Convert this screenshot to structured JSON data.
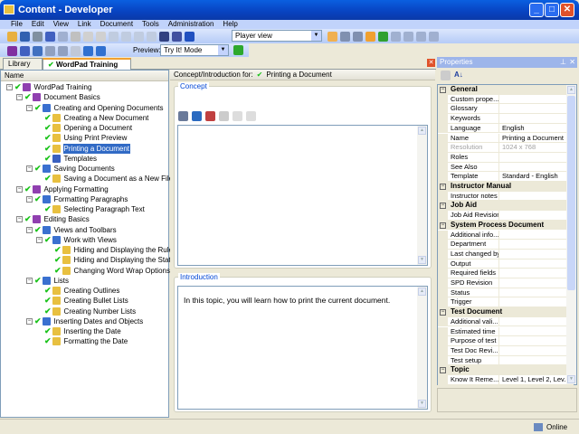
{
  "window": {
    "title": "Content - Developer",
    "minimize": "_",
    "maximize": "□",
    "close": "✕"
  },
  "menu": [
    "File",
    "Edit",
    "View",
    "Link",
    "Document",
    "Tools",
    "Administration",
    "Help"
  ],
  "toolbar": {
    "view_select": "Player view",
    "preview_label": "Preview:",
    "preview_select": "Try It! Mode"
  },
  "tabs": [
    {
      "label": "Library"
    },
    {
      "label": "WordPad Training"
    }
  ],
  "tree": {
    "header": "Name",
    "items": [
      {
        "label": "WordPad Training",
        "level": 0,
        "type": "book",
        "expand": "-"
      },
      {
        "label": "Document Basics",
        "level": 1,
        "type": "book",
        "expand": "-"
      },
      {
        "label": "Creating and Opening Documents",
        "level": 2,
        "type": "section",
        "expand": "-"
      },
      {
        "label": "Creating a New Document",
        "level": 3,
        "type": "topic"
      },
      {
        "label": "Opening a Document",
        "level": 3,
        "type": "topic"
      },
      {
        "label": "Using Print Preview",
        "level": 3,
        "type": "topic"
      },
      {
        "label": "Printing a Document",
        "level": 3,
        "type": "topic",
        "selected": true
      },
      {
        "label": "Templates",
        "level": 3,
        "type": "page"
      },
      {
        "label": "Saving Documents",
        "level": 2,
        "type": "section",
        "expand": "-"
      },
      {
        "label": "Saving a Document as a New File",
        "level": 3,
        "type": "topic"
      },
      {
        "label": "Applying Formatting",
        "level": 1,
        "type": "book",
        "expand": "-"
      },
      {
        "label": "Formatting Paragraphs",
        "level": 2,
        "type": "section",
        "expand": "-"
      },
      {
        "label": "Selecting Paragraph Text",
        "level": 3,
        "type": "topic"
      },
      {
        "label": "Editing Basics",
        "level": 1,
        "type": "book",
        "expand": "-"
      },
      {
        "label": "Views and Toolbars",
        "level": 2,
        "type": "section",
        "expand": "-"
      },
      {
        "label": "Work with Views",
        "level": 3,
        "type": "section",
        "expand": "-"
      },
      {
        "label": "Hiding and Displaying the Ruler",
        "level": 4,
        "type": "topic"
      },
      {
        "label": "Hiding and Displaying the Status Bar",
        "level": 4,
        "type": "topic"
      },
      {
        "label": "Changing Word Wrap Options",
        "level": 4,
        "type": "topic"
      },
      {
        "label": "Lists",
        "level": 2,
        "type": "section",
        "expand": "-"
      },
      {
        "label": "Creating Outlines",
        "level": 3,
        "type": "topic"
      },
      {
        "label": "Creating Bullet Lists",
        "level": 3,
        "type": "topic"
      },
      {
        "label": "Creating Number Lists",
        "level": 3,
        "type": "topic"
      },
      {
        "label": "Inserting Dates and Objects",
        "level": 2,
        "type": "section",
        "expand": "-"
      },
      {
        "label": "Inserting the Date",
        "level": 3,
        "type": "topic"
      },
      {
        "label": "Formatting the Date",
        "level": 3,
        "type": "topic"
      }
    ]
  },
  "center": {
    "header_label": "Concept/Introduction for:",
    "header_doc": "Printing a Document",
    "concept_title": "Concept",
    "concept_text": "",
    "intro_title": "Introduction",
    "intro_text": "In this topic, you will learn how to print the current document."
  },
  "properties": {
    "title": "Properties",
    "rows": [
      {
        "cat": "General"
      },
      {
        "k": "Custom prope...",
        "v": ""
      },
      {
        "k": "Glossary",
        "v": ""
      },
      {
        "k": "Keywords",
        "v": ""
      },
      {
        "k": "Language",
        "v": "English"
      },
      {
        "k": "Name",
        "v": "Printing a Document"
      },
      {
        "k": "Resolution",
        "v": "1024 x 768",
        "disabled": true
      },
      {
        "k": "Roles",
        "v": ""
      },
      {
        "k": "See Also",
        "v": ""
      },
      {
        "k": "Template",
        "v": "Standard - English"
      },
      {
        "cat": "Instructor Manual"
      },
      {
        "k": "Instructor notes",
        "v": ""
      },
      {
        "cat": "Job Aid"
      },
      {
        "k": "Job Aid Revision",
        "v": ""
      },
      {
        "cat": "System Process Document"
      },
      {
        "k": "Additional info...",
        "v": ""
      },
      {
        "k": "Department",
        "v": ""
      },
      {
        "k": "Last changed by",
        "v": ""
      },
      {
        "k": "Output",
        "v": ""
      },
      {
        "k": "Required fields",
        "v": ""
      },
      {
        "k": "SPD Revision",
        "v": ""
      },
      {
        "k": "Status",
        "v": ""
      },
      {
        "k": "Trigger",
        "v": ""
      },
      {
        "cat": "Test Document"
      },
      {
        "k": "Additional vali...",
        "v": ""
      },
      {
        "k": "Estimated time",
        "v": ""
      },
      {
        "k": "Purpose of test",
        "v": ""
      },
      {
        "k": "Test Doc Revi...",
        "v": ""
      },
      {
        "k": "Test setup",
        "v": ""
      },
      {
        "cat": "Topic"
      },
      {
        "k": "Know It Reme...",
        "v": "Level 1, Level 2, Lev..."
      }
    ]
  },
  "status": {
    "connection": "Online"
  },
  "colors": {
    "titlebar": "#0842c0",
    "selection": "#316ac5",
    "check": "#1ac21a",
    "accent_tab": "#f0a030"
  }
}
